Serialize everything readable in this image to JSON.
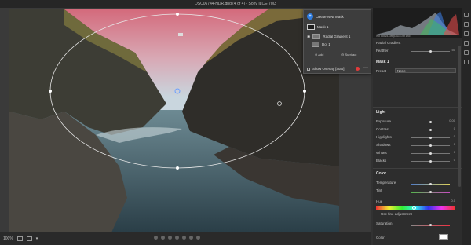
{
  "titlebar": {
    "text": "DSC06744-HDR.dng (4 of 4) · Sony ILCE-7M3"
  },
  "bottombar": {
    "zoom": "100%"
  },
  "mask_panel": {
    "create_label": "Create New Mask",
    "mask1_label": "Mask 1",
    "grad_label": "Radial Gradient 1",
    "dot_label": "Dot 1",
    "add_label": "Add",
    "subtract_label": "Subtract",
    "overlay_label": "Show Overlay [auto]"
  },
  "histogram": {
    "readout": "ISO 100   24-105@24mm   f/8   1/60"
  },
  "right": {
    "radial_gradient": "Radial Gradient",
    "feather_label": "Feather",
    "feather_value": "50",
    "mask_label": "Mask 1",
    "preset_label": "Preset",
    "preset_value": "None",
    "light_header": "Light",
    "sliders": [
      {
        "label": "Exposure",
        "value": "0.00",
        "pos": 0.5
      },
      {
        "label": "Contrast",
        "value": "0",
        "pos": 0.5
      },
      {
        "label": "Highlights",
        "value": "0",
        "pos": 0.5
      },
      {
        "label": "Shadows",
        "value": "0",
        "pos": 0.5
      },
      {
        "label": "Whites",
        "value": "0",
        "pos": 0.5
      },
      {
        "label": "Blacks",
        "value": "0",
        "pos": 0.5
      }
    ],
    "color_header": "Color",
    "temperature_label": "Temperature",
    "tint_label": "Tint",
    "hue_label": "Hue",
    "hue_value": "0.0",
    "fine_adjust_label": "Use fine adjustment",
    "saturation_label": "Saturation",
    "color_label": "Color"
  }
}
